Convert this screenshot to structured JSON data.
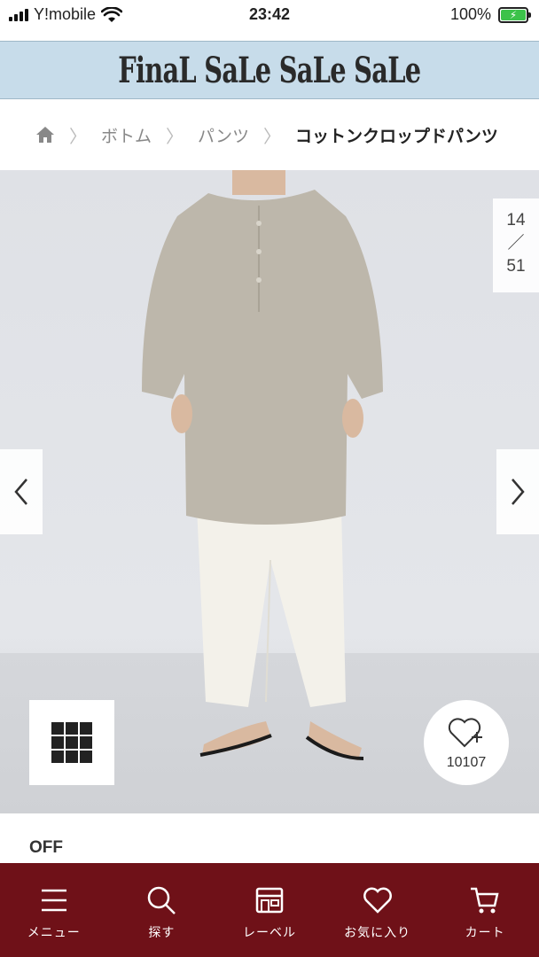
{
  "status_bar": {
    "carrier": "Y!mobile",
    "time": "23:42",
    "battery": "100%"
  },
  "banner": {
    "text": "FinaL SaLe SaLe SaLe"
  },
  "breadcrumb": {
    "items": [
      "ボトム",
      "パンツ"
    ],
    "current": "コットンクロップドパンツ"
  },
  "gallery": {
    "current": "14",
    "separator": "／",
    "total": "51",
    "favorite_count": "10107"
  },
  "price": {
    "off_label": "OFF"
  },
  "bottom_nav": {
    "items": [
      {
        "label": "メニュー",
        "icon": "menu-icon"
      },
      {
        "label": "探す",
        "icon": "search-icon"
      },
      {
        "label": "レーベル",
        "icon": "shop-icon"
      },
      {
        "label": "お気に入り",
        "icon": "heart-icon"
      },
      {
        "label": "カート",
        "icon": "cart-icon"
      }
    ]
  },
  "colors": {
    "banner_bg": "#c7dcea",
    "nav_bg": "#6f1118",
    "battery": "#3cc24a"
  }
}
